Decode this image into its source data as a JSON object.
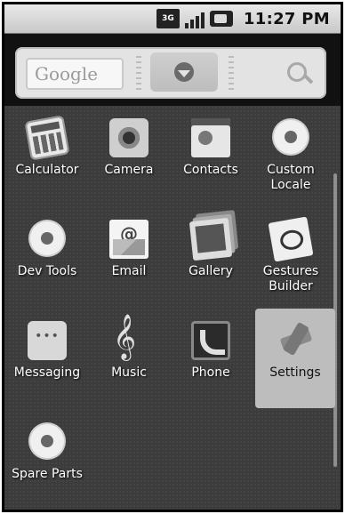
{
  "status_bar": {
    "network_label": "3G",
    "time": "11:27 PM",
    "icons": [
      "3g-icon",
      "signal-icon",
      "battery-icon"
    ]
  },
  "search_widget": {
    "placeholder_brand": "Google",
    "icons": [
      "google-logo",
      "drawer-handle-icon",
      "search-icon"
    ]
  },
  "apps": [
    {
      "label": "Calculator",
      "icon": "calculator-icon",
      "selected": false
    },
    {
      "label": "Camera",
      "icon": "camera-icon",
      "selected": false
    },
    {
      "label": "Contacts",
      "icon": "contacts-icon",
      "selected": false
    },
    {
      "label": "Custom Locale",
      "icon": "gear-icon",
      "selected": false
    },
    {
      "label": "Dev Tools",
      "icon": "gear-icon",
      "selected": false
    },
    {
      "label": "Email",
      "icon": "email-icon",
      "selected": false
    },
    {
      "label": "Gallery",
      "icon": "gallery-icon",
      "selected": false
    },
    {
      "label": "Gestures Builder",
      "icon": "gestures-icon",
      "selected": false
    },
    {
      "label": "Messaging",
      "icon": "messaging-icon",
      "selected": false
    },
    {
      "label": "Music",
      "icon": "music-icon",
      "selected": false
    },
    {
      "label": "Phone",
      "icon": "phone-icon",
      "selected": false
    },
    {
      "label": "Settings",
      "icon": "settings-icon",
      "selected": true
    },
    {
      "label": "Spare Parts",
      "icon": "gear-icon",
      "selected": false
    }
  ],
  "colors": {
    "drawer_background": "#3c3c3c",
    "selected_highlight": "#bdbdbd",
    "status_bar": "#d9d9d9"
  }
}
